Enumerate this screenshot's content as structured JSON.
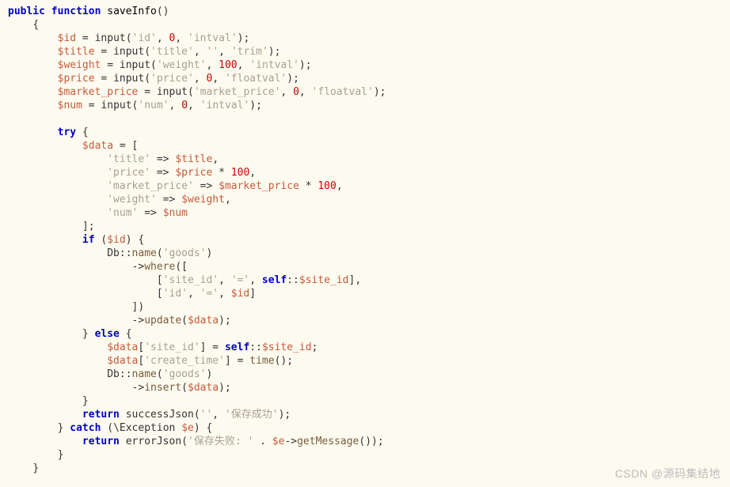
{
  "code": {
    "line1_kw1": "public",
    "line1_kw2": "function",
    "line1_fn": "saveInfo",
    "line1_suffix": "()",
    "line2": "{",
    "line3_var": "$id",
    "line3_mid": " = input(",
    "line3_str": "'id'",
    "line3_mid2": ", ",
    "line3_num": "0",
    "line3_mid3": ", ",
    "line3_str2": "'intval'",
    "line3_end": ");",
    "line4_var": "$title",
    "line4_mid": " = input(",
    "line4_str": "'title'",
    "line4_mid2": ", ",
    "line4_str2": "''",
    "line4_mid3": ", ",
    "line4_str3": "'trim'",
    "line4_end": ");",
    "line5_var": "$weight",
    "line5_mid": " = input(",
    "line5_str": "'weight'",
    "line5_mid2": ", ",
    "line5_num": "100",
    "line5_mid3": ", ",
    "line5_str2": "'intval'",
    "line5_end": ");",
    "line6_var": "$price",
    "line6_mid": " = input(",
    "line6_str": "'price'",
    "line6_mid2": ", ",
    "line6_num": "0",
    "line6_mid3": ", ",
    "line6_str2": "'floatval'",
    "line6_end": ");",
    "line7_var": "$market_price",
    "line7_mid": " = input(",
    "line7_str": "'market_price'",
    "line7_mid2": ", ",
    "line7_num": "0",
    "line7_mid3": ", ",
    "line7_str2": "'floatval'",
    "line7_end": ");",
    "line8_var": "$num",
    "line8_mid": " = input(",
    "line8_str": "'num'",
    "line8_mid2": ", ",
    "line8_num": "0",
    "line8_mid3": ", ",
    "line8_str2": "'intval'",
    "line8_end": ");",
    "line10_kw": "try",
    "line10_end": " {",
    "line11_var": "$data",
    "line11_end": " = [",
    "line12_str": "'title'",
    "line12_mid": " => ",
    "line12_var": "$title",
    "line12_end": ",",
    "line13_str": "'price'",
    "line13_mid": " => ",
    "line13_var": "$price",
    "line13_op": " * ",
    "line13_num": "100",
    "line13_end": ",",
    "line14_str": "'market_price'",
    "line14_mid": " => ",
    "line14_var": "$market_price",
    "line14_op": " * ",
    "line14_num": "100",
    "line14_end": ",",
    "line15_str": "'weight'",
    "line15_mid": " => ",
    "line15_var": "$weight",
    "line15_end": ",",
    "line16_str": "'num'",
    "line16_mid": " => ",
    "line16_var": "$num",
    "line17": "];",
    "line18_kw": "if",
    "line18_mid": " (",
    "line18_var": "$id",
    "line18_end": ") {",
    "line19_pre": "Db::",
    "line19_fn": "name",
    "line19_mid": "(",
    "line19_str": "'goods'",
    "line19_end": ")",
    "line20_pre": "->",
    "line20_fn": "where",
    "line20_end": "([",
    "line21_pre": "[",
    "line21_str": "'site_id'",
    "line21_mid": ", ",
    "line21_str2": "'='",
    "line21_mid2": ", ",
    "line21_kw": "self",
    "line21_mid3": "::",
    "line21_var": "$site_id",
    "line21_end": "],",
    "line22_pre": "[",
    "line22_str": "'id'",
    "line22_mid": ", ",
    "line22_str2": "'='",
    "line22_mid2": ", ",
    "line22_var": "$id",
    "line22_end": "]",
    "line23": "])",
    "line24_pre": "->",
    "line24_fn": "update",
    "line24_mid": "(",
    "line24_var": "$data",
    "line24_end": ");",
    "line25_pre": "} ",
    "line25_kw": "else",
    "line25_end": " {",
    "line26_var": "$data",
    "line26_mid": "[",
    "line26_str": "'site_id'",
    "line26_mid2": "] = ",
    "line26_kw": "self",
    "line26_mid3": "::",
    "line26_var2": "$site_id",
    "line26_end": ";",
    "line27_var": "$data",
    "line27_mid": "[",
    "line27_str": "'create_time'",
    "line27_mid2": "] = ",
    "line27_fn": "time",
    "line27_end": "();",
    "line28_pre": "Db::",
    "line28_fn": "name",
    "line28_mid": "(",
    "line28_str": "'goods'",
    "line28_end": ")",
    "line29_pre": "->",
    "line29_fn": "insert",
    "line29_mid": "(",
    "line29_var": "$data",
    "line29_end": ");",
    "line30": "}",
    "line31_kw": "return",
    "line31_fn": " successJson",
    "line31_mid": "(",
    "line31_str": "''",
    "line31_mid2": ", ",
    "line31_str2": "'保存成功'",
    "line31_end": ");",
    "line32_pre": "} ",
    "line32_kw": "catch",
    "line32_mid": " (\\",
    "line32_cls": "Exception",
    "line32_sp": " ",
    "line32_var": "$e",
    "line32_end": ") {",
    "line33_kw": "return",
    "line33_fn": " errorJson",
    "line33_mid": "(",
    "line33_str": "'保存失败: '",
    "line33_mid2": " . ",
    "line33_var": "$e",
    "line33_mid3": "->",
    "line33_fn2": "getMessage",
    "line33_end": "());",
    "line34": "}",
    "line35": "}"
  },
  "watermark": "CSDN @源码集结地"
}
